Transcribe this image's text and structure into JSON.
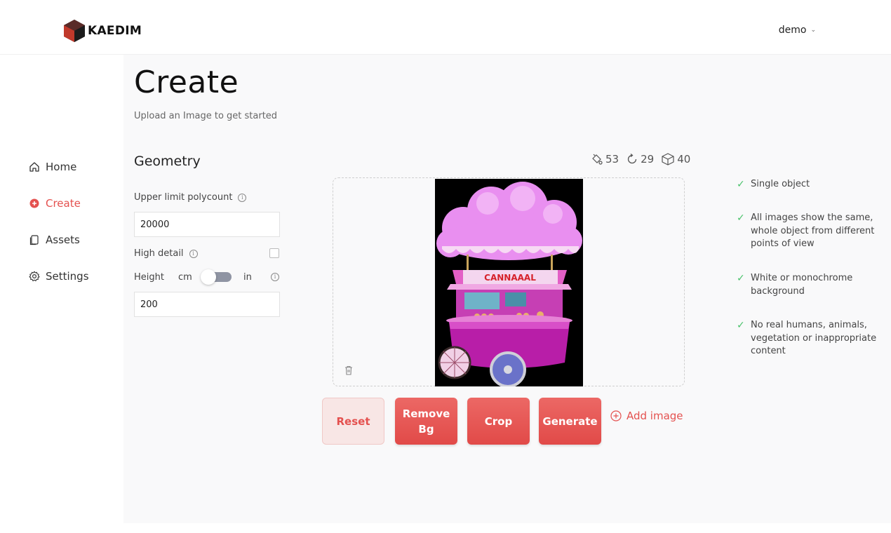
{
  "header": {
    "brand": "KAEDIM",
    "user": "demo"
  },
  "sidebar": {
    "items": [
      {
        "label": "Home",
        "icon": "home-icon"
      },
      {
        "label": "Create",
        "icon": "plus-circle-icon",
        "active": true
      },
      {
        "label": "Assets",
        "icon": "copy-icon"
      },
      {
        "label": "Settings",
        "icon": "gear-icon"
      }
    ]
  },
  "main": {
    "title": "Create",
    "subtitle": "Upload an Image to get started",
    "section_title": "Geometry",
    "stats": {
      "left": "53",
      "refresh": "29",
      "models": "40"
    },
    "form": {
      "polycount_label": "Upper limit polycount",
      "polycount_value": "20000",
      "high_detail_label": "High detail",
      "high_detail_checked": false,
      "height_label": "Height",
      "unit_cm": "cm",
      "unit_in": "in",
      "height_value": "200"
    },
    "checklist": [
      "Single object",
      "All images show the same, whole object from different points of view",
      "White or monochrome background",
      "No real humans, animals, vegetation or inappropriate content"
    ],
    "preview_sign": "CANNAAAL",
    "buttons": {
      "reset": "Reset",
      "remove_bg": "Remove Bg",
      "crop": "Crop",
      "generate": "Generate",
      "add_image": "Add image"
    }
  },
  "colors": {
    "accent": "#e4514f",
    "check": "#4ac26b",
    "background": "#f9f9fa"
  }
}
